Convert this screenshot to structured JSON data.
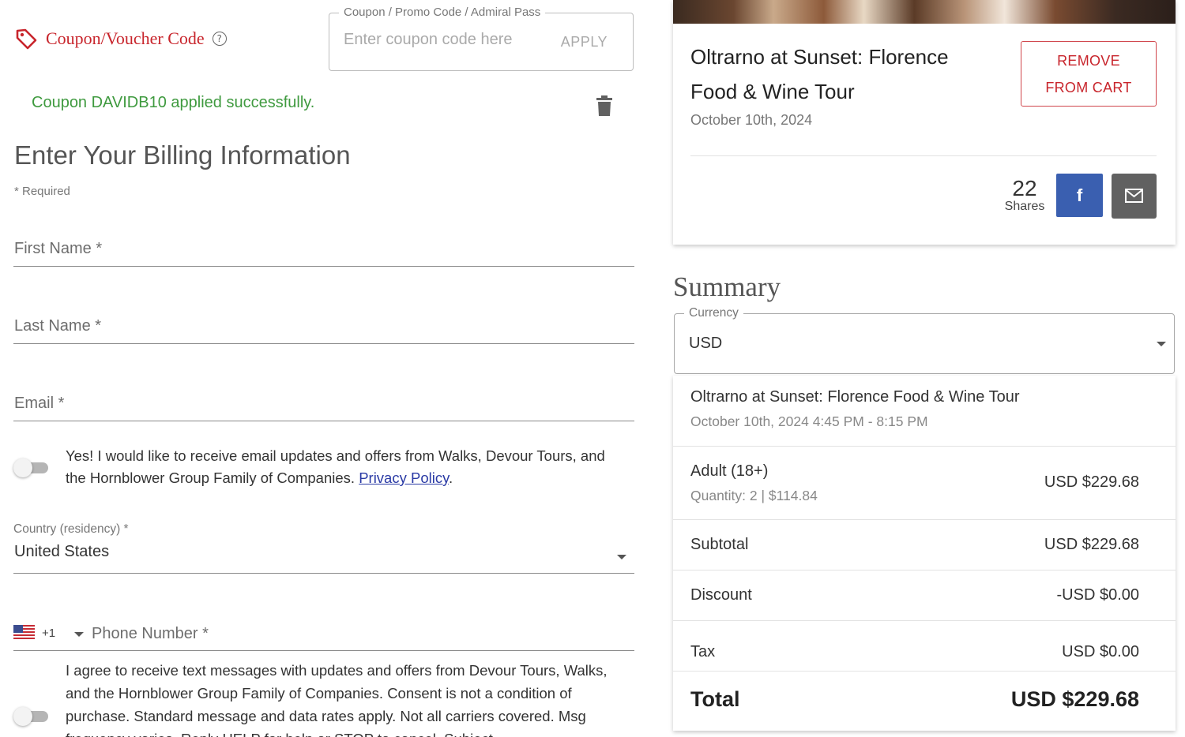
{
  "coupon": {
    "heading": "Coupon/Voucher Code",
    "field_legend": "Coupon / Promo Code / Admiral Pass",
    "placeholder": "Enter coupon code here",
    "apply_label": "APPLY",
    "success_message": "Coupon DAVIDB10 applied successfully."
  },
  "billing": {
    "title": "Enter Your Billing Information",
    "required_note": "* Required",
    "first_name_label": "First Name *",
    "last_name_label": "Last Name *",
    "email_label": "Email *",
    "email_consent_text": "Yes! I would like to receive email updates and offers from Walks, Devour Tours, and the Hornblower Group Family of Companies.",
    "privacy_link": "Privacy Policy",
    "country_label": "Country (residency) *",
    "country_value": "United States",
    "phone_code": "+1",
    "phone_label": "Phone Number *",
    "sms_consent_text": "I agree to receive text messages with updates and offers from Devour Tours, Walks, and the Hornblower Group Family of Companies. Consent is not a condition of purchase. Standard message and data rates apply. Not all carriers covered. Msg frequency varies. Reply HELP for help or STOP to cancel. Subject",
    "email_toggle_on": false,
    "sms_toggle_on": false
  },
  "tour_card": {
    "title": "Oltrarno at Sunset: Florence Food & Wine Tour",
    "date": "October 10th, 2024",
    "remove_label_line1": "REMOVE",
    "remove_label_line2": "FROM CART",
    "shares_count": "22",
    "shares_label": "Shares",
    "facebook_label": "f"
  },
  "summary": {
    "title": "Summary",
    "currency_legend": "Currency",
    "currency_value": "USD",
    "tour_name": "Oltrarno at Sunset: Florence Food & Wine Tour",
    "tour_datetime": "October 10th, 2024 4:45 PM - 8:15 PM",
    "adult_label": "Adult (18+)",
    "adult_detail": "Quantity: 2 | $114.84",
    "adult_amount": "USD $229.68",
    "subtotal_label": "Subtotal",
    "subtotal_amount": "USD $229.68",
    "discount_label": "Discount",
    "discount_amount": "-USD $0.00",
    "tax_label": "Tax",
    "tax_amount": "USD $0.00",
    "total_label": "Total",
    "total_amount": "USD $229.68"
  },
  "colors": {
    "brand_red": "#c8252c",
    "success_green": "#3f9a3f",
    "facebook_blue": "#3a5fb0",
    "link_blue": "#2a3aa5"
  },
  "icons": [
    "tag-icon",
    "help-icon",
    "trash-icon",
    "us-flag-icon",
    "chevron-down-icon",
    "facebook-icon",
    "mail-icon"
  ]
}
